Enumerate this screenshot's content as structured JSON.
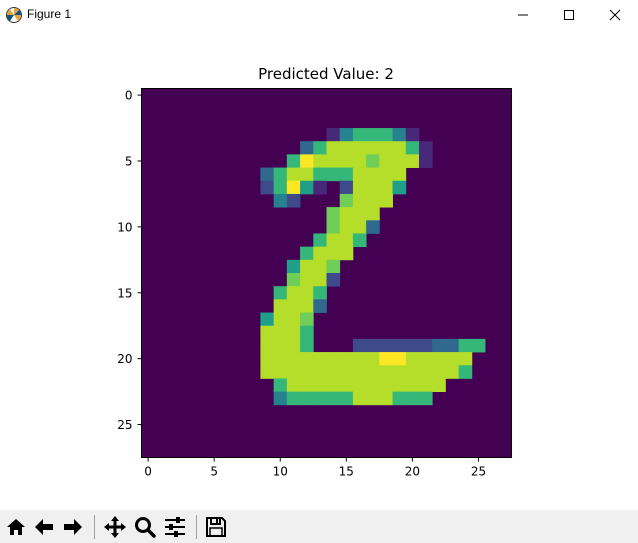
{
  "window": {
    "title": "Figure 1",
    "app_icon": "matplotlib-icon",
    "controls": [
      "minimize-icon",
      "maximize-icon",
      "close-icon"
    ]
  },
  "toolbar": {
    "buttons": [
      {
        "name": "home-button",
        "icon": "home-icon"
      },
      {
        "name": "back-button",
        "icon": "arrow-left-icon"
      },
      {
        "name": "forward-button",
        "icon": "arrow-right-icon"
      },
      {
        "name": "pan-button",
        "icon": "move-icon"
      },
      {
        "name": "zoom-button",
        "icon": "magnifier-icon"
      },
      {
        "name": "subplots-button",
        "icon": "sliders-icon"
      },
      {
        "name": "save-button",
        "icon": "floppy-disk-icon"
      }
    ]
  },
  "chart_data": {
    "type": "heatmap",
    "title": "Predicted Value: 2",
    "xlabel": "",
    "ylabel": "",
    "colormap": "viridis",
    "xlim": [
      -0.5,
      27.5
    ],
    "ylim": [
      27.5,
      -0.5
    ],
    "xticks": [
      0,
      5,
      10,
      15,
      20,
      25
    ],
    "yticks": [
      0,
      5,
      10,
      15,
      20,
      25
    ],
    "grid": false,
    "rows": 28,
    "cols": 28,
    "values": [
      "............................",
      "............................",
      "............................",
      "..............1466641.......",
      "............3688888861......",
      "...........69888878881......",
      ".........36886668888........",
      ".........26951.28885........",
      "..........42...7888.........",
      "..............7888..........",
      "..............7883..........",
      ".............6886...........",
      "............6888............",
      "...........5887.............",
      "...........7882.............",
      "..........6886..............",
      "..........8883..............",
      ".........5887...............",
      ".........8886...............",
      ".........8886...2222223366..",
      ".........8888888889988888...",
      ".........8888888888888886...",
      "..........6888888888888.....",
      "..........466666888666......",
      "............................",
      "............................",
      "............................",
      "............................"
    ]
  },
  "colors": {
    "viridis_min": "#440154",
    "viridis_max": "#fde725"
  }
}
